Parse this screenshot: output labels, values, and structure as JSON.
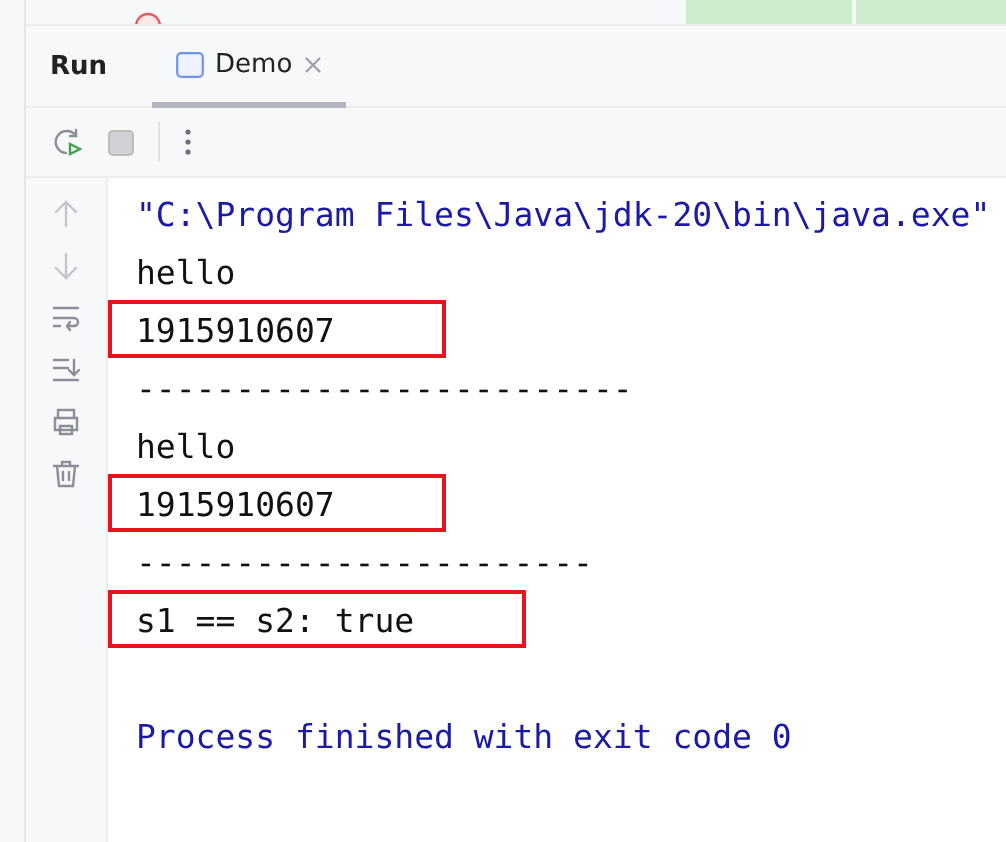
{
  "tool_window": {
    "title": "Run",
    "tabs": [
      {
        "label": "Demo",
        "selected": true
      }
    ]
  },
  "console": {
    "lines": [
      {
        "kind": "command",
        "text": "\"C:\\Program Files\\Java\\jdk-20\\bin\\java.exe\"",
        "highlighted": false
      },
      {
        "kind": "output",
        "text": "hello",
        "highlighted": false
      },
      {
        "kind": "output",
        "text": "1915910607",
        "highlighted": true
      },
      {
        "kind": "output",
        "text": "-------------------------",
        "highlighted": false
      },
      {
        "kind": "output",
        "text": "hello",
        "highlighted": false
      },
      {
        "kind": "output",
        "text": "1915910607",
        "highlighted": true
      },
      {
        "kind": "output",
        "text": "-----------------------",
        "highlighted": false
      },
      {
        "kind": "output",
        "text": "s1 == s2: true",
        "highlighted": true
      },
      {
        "kind": "blank",
        "highlighted": false
      },
      {
        "kind": "exit",
        "text": "Process finished with exit code 0",
        "highlighted": false
      }
    ]
  }
}
